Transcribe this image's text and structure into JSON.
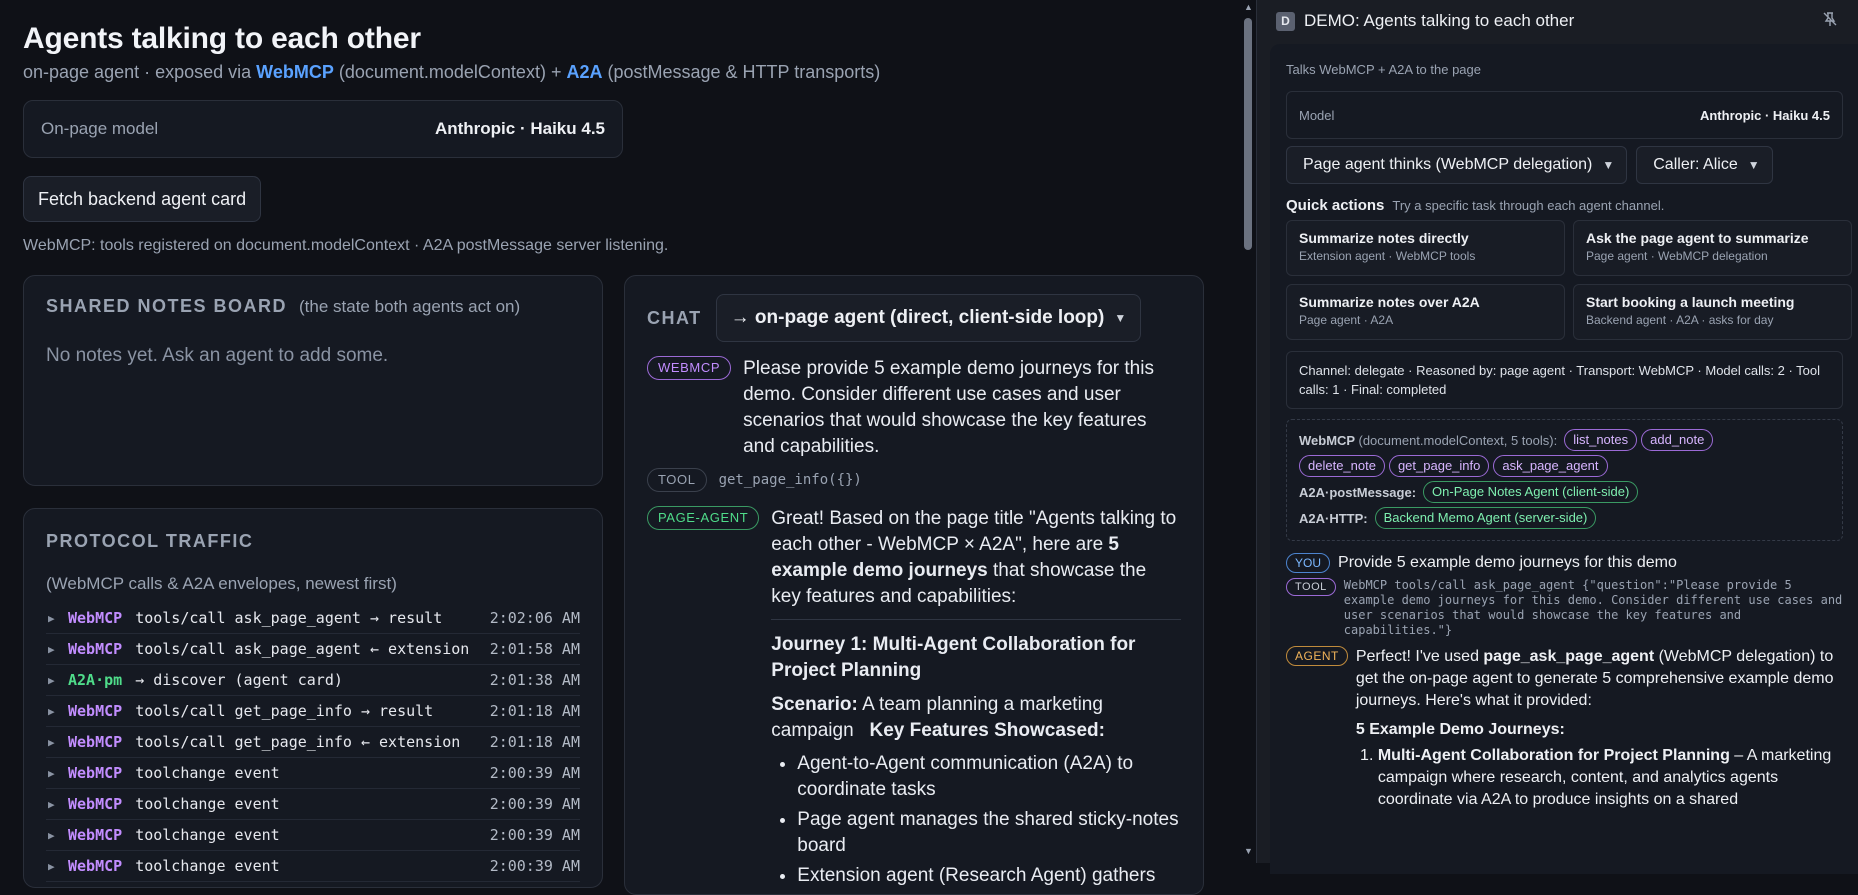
{
  "main": {
    "title": "Agents talking to each other",
    "subtitle_pre": "on-page agent · exposed via ",
    "subtitle_webmcp": "WebMCP",
    "subtitle_mid": " (document.modelContext) + ",
    "subtitle_a2a": "A2A",
    "subtitle_post": " (postMessage & HTTP transports)",
    "model_label": "On-page model",
    "model_value": "Anthropic · Haiku 4.5",
    "fetch_button": "Fetch backend agent card",
    "status": "WebMCP: tools registered on document.modelContext · A2A postMessage server listening."
  },
  "notes_board": {
    "title": "SHARED NOTES BOARD",
    "subtitle": "(the state both agents act on)",
    "empty": "No notes yet. Ask an agent to add some."
  },
  "traffic": {
    "title": "PROTOCOL TRAFFIC",
    "subtitle": "(WebMCP calls & A2A envelopes, newest first)",
    "rows": [
      {
        "tag": "WebMCP",
        "msg": "tools/call ask_page_agent → result",
        "time": "2:02:06 AM"
      },
      {
        "tag": "WebMCP",
        "msg": "tools/call ask_page_agent ← extension",
        "time": "2:01:58 AM"
      },
      {
        "tag": "A2A·pm",
        "msg": "→ discover (agent card)",
        "time": "2:01:38 AM"
      },
      {
        "tag": "WebMCP",
        "msg": "tools/call get_page_info → result",
        "time": "2:01:18 AM"
      },
      {
        "tag": "WebMCP",
        "msg": "tools/call get_page_info ← extension",
        "time": "2:01:18 AM"
      },
      {
        "tag": "WebMCP",
        "msg": "toolchange event",
        "time": "2:00:39 AM"
      },
      {
        "tag": "WebMCP",
        "msg": "toolchange event",
        "time": "2:00:39 AM"
      },
      {
        "tag": "WebMCP",
        "msg": "toolchange event",
        "time": "2:00:39 AM"
      },
      {
        "tag": "WebMCP",
        "msg": "toolchange event",
        "time": "2:00:39 AM"
      }
    ]
  },
  "chat": {
    "title": "CHAT",
    "target": "→ on-page agent (direct, client-side loop)",
    "webmcp_label": "WEBMCP",
    "webmcp_text": "Please provide 5 example demo journeys for this demo. Consider different use cases and user scenarios that would showcase the key features and capabilities.",
    "tool_label": "TOOL",
    "tool_text": "get_page_info({})",
    "agent_label": "PAGE-AGENT",
    "agent_intro_pre": "Great! Based on the page title \"Agents talking to each other - WebMCP × A2A\", here are ",
    "agent_intro_bold": "5 example demo journeys",
    "agent_intro_post": " that showcase the key features and capabilities:",
    "journey1_title": "Journey 1: Multi-Agent Collaboration for Project Planning",
    "scenario_label": "Scenario:",
    "scenario_text": " A team planning a marketing campaign",
    "features_label": "Key Features Showcased:",
    "bullets": [
      "Agent-to-Agent communication (A2A) to coordinate tasks",
      "Page agent manages the shared sticky-notes board",
      "Extension agent (Research Agent) gathers"
    ]
  },
  "sidebar": {
    "badge": "D",
    "title": "DEMO: Agents talking to each other",
    "pin_icon": "pin-off-icon",
    "tagline": "Talks WebMCP + A2A to the page",
    "model_label": "Model",
    "model_value": "Anthropic · Haiku 4.5",
    "mode_select": "Page agent thinks (WebMCP delegation)",
    "caller_select": "Caller: Alice",
    "quick_title": "Quick actions",
    "quick_sub": "Try a specific task through each agent channel.",
    "quick_actions": [
      {
        "title": "Summarize notes directly",
        "sub": "Extension agent · WebMCP tools"
      },
      {
        "title": "Ask the page agent to summarize",
        "sub": "Page agent · WebMCP delegation"
      },
      {
        "title": "Summarize notes over A2A",
        "sub": "Page agent · A2A"
      },
      {
        "title": "Start booking a launch meeting",
        "sub": "Backend agent · A2A · asks for day"
      }
    ],
    "channel_info": "Channel: delegate · Reasoned by: page agent · Transport: WebMCP · Model calls: 2 · Tool calls: 1 · Final: completed",
    "webmcp_label": "WebMCP",
    "webmcp_label_sub": "(document.modelContext, 5 tools):",
    "tools": [
      "list_notes",
      "add_note",
      "delete_note",
      "get_page_info",
      "ask_page_agent"
    ],
    "a2a_pm_label": "A2A·postMessage:",
    "a2a_pm_agent": "On-Page Notes Agent (client-side)",
    "a2a_http_label": "A2A·HTTP:",
    "a2a_http_agent": "Backend Memo Agent (server-side)",
    "you_label": "YOU",
    "you_text": "Provide 5 example demo journeys for this demo",
    "tool_label": "TOOL",
    "tool_text": "WebMCP tools/call ask_page_agent {\"question\":\"Please provide 5 example demo journeys for this demo. Consider different use cases and user scenarios that would showcase the key features and capabilities.\"}",
    "agent_label": "AGENT",
    "agent_pre": "Perfect! I've used ",
    "agent_bold": "page_ask_page_agent",
    "agent_post": " (WebMCP delegation) to get the on-page agent to generate 5 comprehensive example demo journeys. Here's what it provided:",
    "journeys_heading": "5 Example Demo Journeys:",
    "journey1_bold": "Multi-Agent Collaboration for Project Planning",
    "journey1_text": " – A marketing campaign where research, content, and analytics agents coordinate via A2A to produce insights on a shared"
  }
}
